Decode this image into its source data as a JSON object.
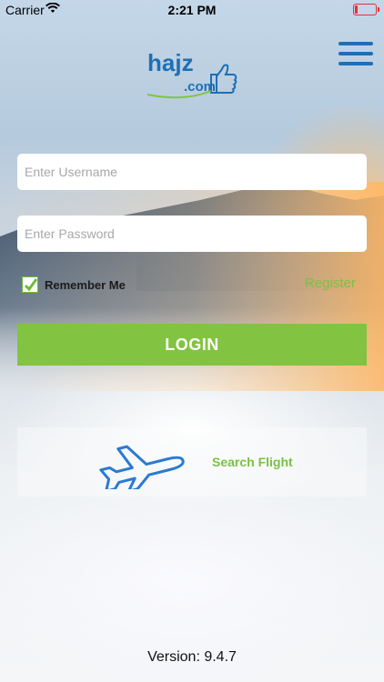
{
  "status_bar": {
    "carrier": "Carrier",
    "time": "2:21 PM",
    "battery_level": 0.12
  },
  "logo": {
    "main": "hajz",
    "sub": ".com"
  },
  "login": {
    "username_placeholder": "Enter Username",
    "password_placeholder": "Enter Password",
    "remember_label": "Remember Me",
    "remember_checked": true,
    "register_label": "Register",
    "login_button": "LOGIN"
  },
  "search": {
    "label": "Search Flight"
  },
  "version": "Version: 9.4.7",
  "colors": {
    "accent_green": "#82c341",
    "brand_blue": "#1f6fb5"
  }
}
